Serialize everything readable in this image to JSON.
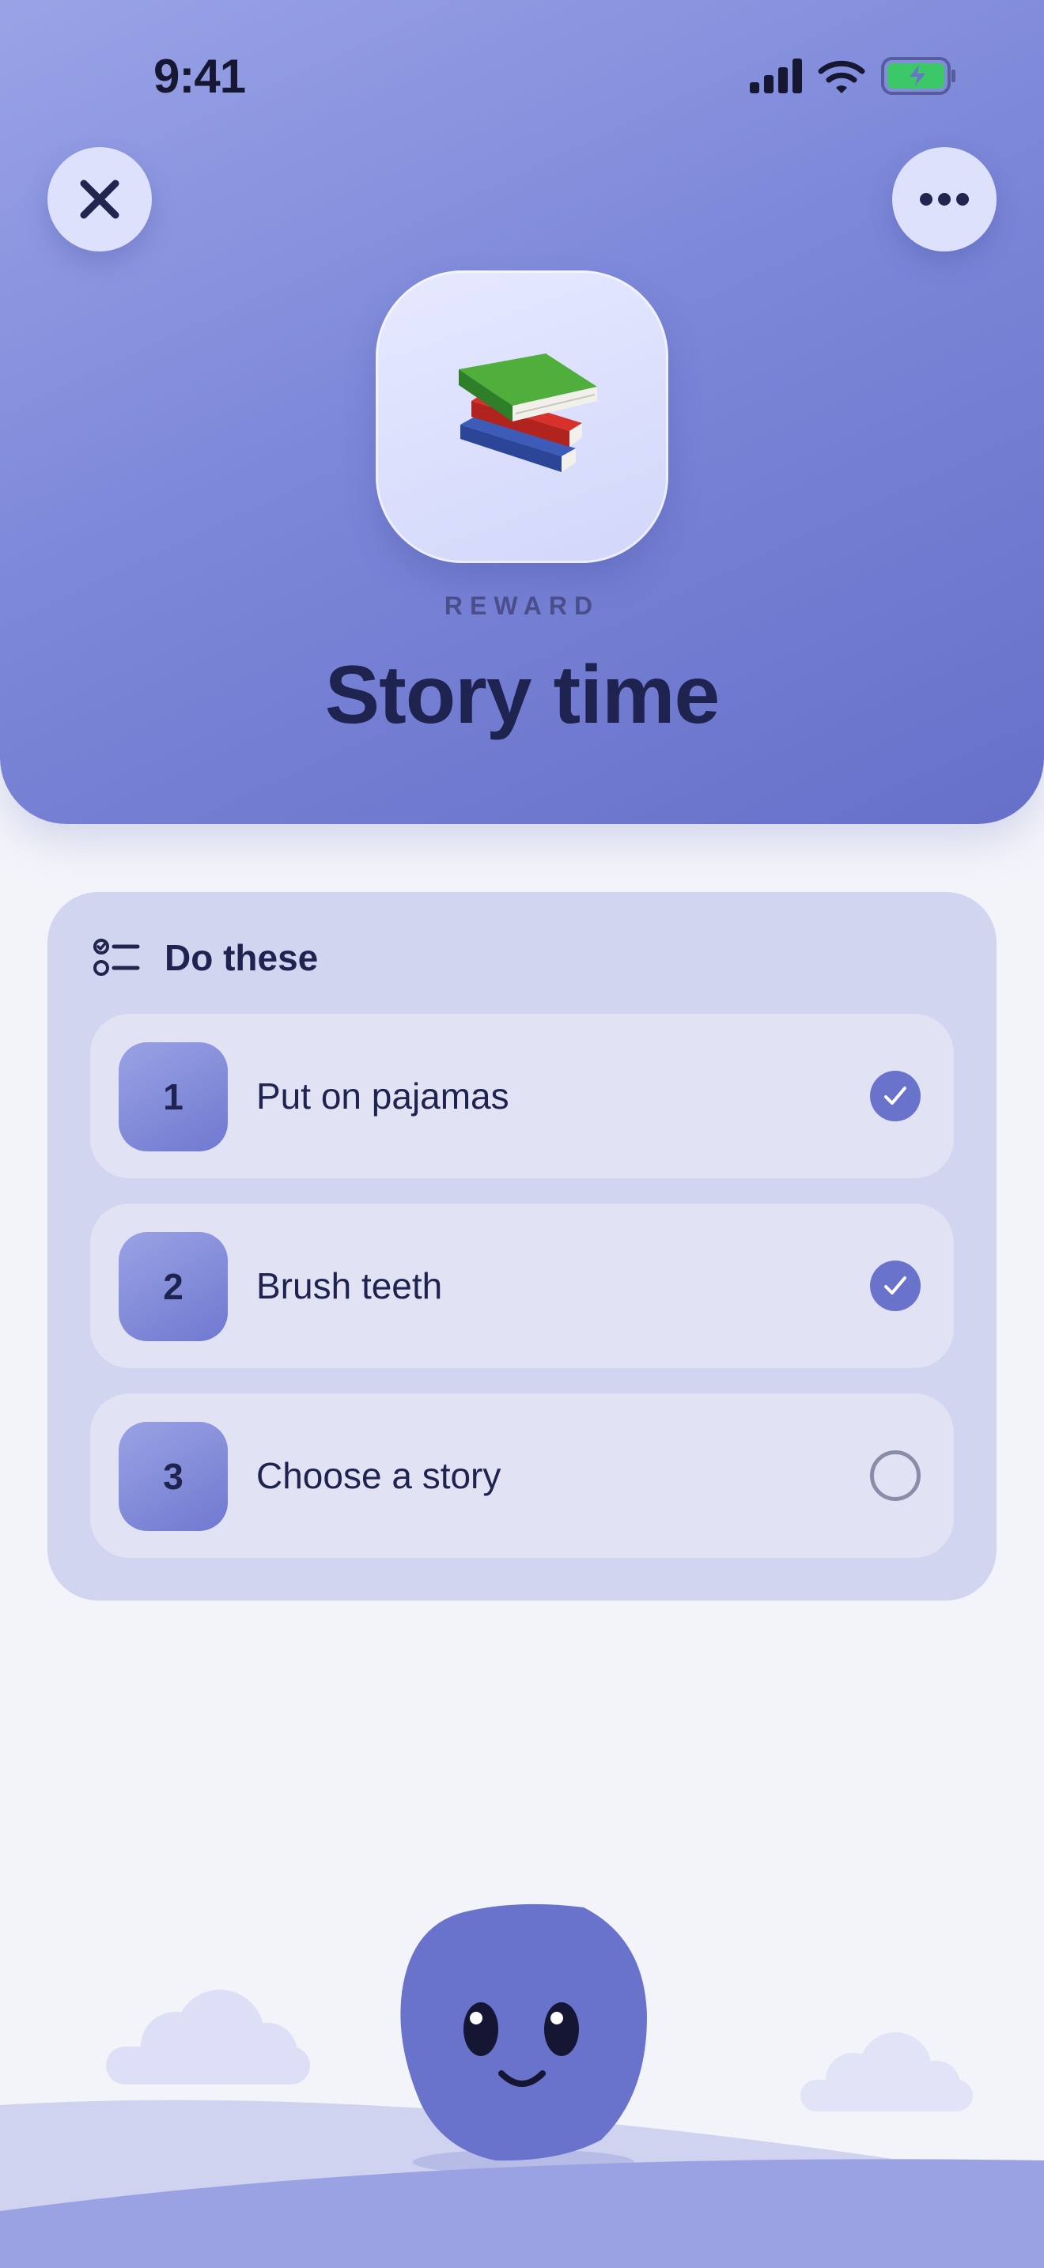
{
  "status_bar": {
    "time": "9:41"
  },
  "header": {
    "close_icon": "close-icon",
    "more_icon": "more-dots-icon",
    "reward_emoji": "books-emoji",
    "eyebrow": "REWARD",
    "title": "Story time"
  },
  "checklist": {
    "icon": "checklist-icon",
    "heading": "Do these",
    "items": [
      {
        "number": "1",
        "label": "Put on pajamas",
        "done": true
      },
      {
        "number": "2",
        "label": "Brush teeth",
        "done": true
      },
      {
        "number": "3",
        "label": "Choose a story",
        "done": false
      }
    ]
  },
  "colors": {
    "accent": "#6a73cc",
    "header_gradient_start": "#9aa3e6",
    "header_gradient_end": "#6670c9",
    "text_dark": "#1f2350",
    "battery_green": "#3cc769"
  }
}
